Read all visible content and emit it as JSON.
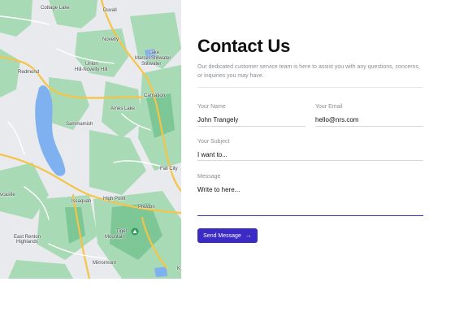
{
  "map": {
    "labels": {
      "cottage_lake": "Cottage Lake",
      "duvall": "Duvall",
      "novelty": "Novelty",
      "lake": "Lake",
      "marcel_stillwater": "Marcel-Stillwater",
      "stillwater": "Stillwater",
      "redmond": "Redmond",
      "union": "Union",
      "hill_novelty_hill": "Hill-Novelty Hill",
      "carnation": "Carnation",
      "ames_lake": "Ames Lake",
      "sammamish": "Sammamish",
      "fall_city": "Fall City",
      "issaquah": "Issaquah",
      "high_point": "High Point",
      "preston": "Preston",
      "newcastle": "vcastle",
      "tiger": "Tiger",
      "mountain": "Mountain",
      "east_renton": "East Renton",
      "highlands": "Highlands",
      "mirrormont": "Mirrormont",
      "edge_k": "K"
    }
  },
  "contact": {
    "title": "Contact Us",
    "subtitle": "Our dedicated customer service team is here to assist you with any questions, concerns, or inquiries you may have.",
    "name_label": "Your Name",
    "name_value": "John Trangely",
    "email_label": "Your Email",
    "email_value": "hello@nrs.com",
    "subject_label": "Your Subject",
    "subject_value": "I want to...",
    "message_label": "Message",
    "message_value": "Write to here...",
    "send_label": "Send Message",
    "send_icon": "arrow-right-icon"
  },
  "colors": {
    "accent": "#3b2bc4",
    "water": "#7fb1f0",
    "park": "#8fd3a5",
    "road": "#f6c445"
  }
}
